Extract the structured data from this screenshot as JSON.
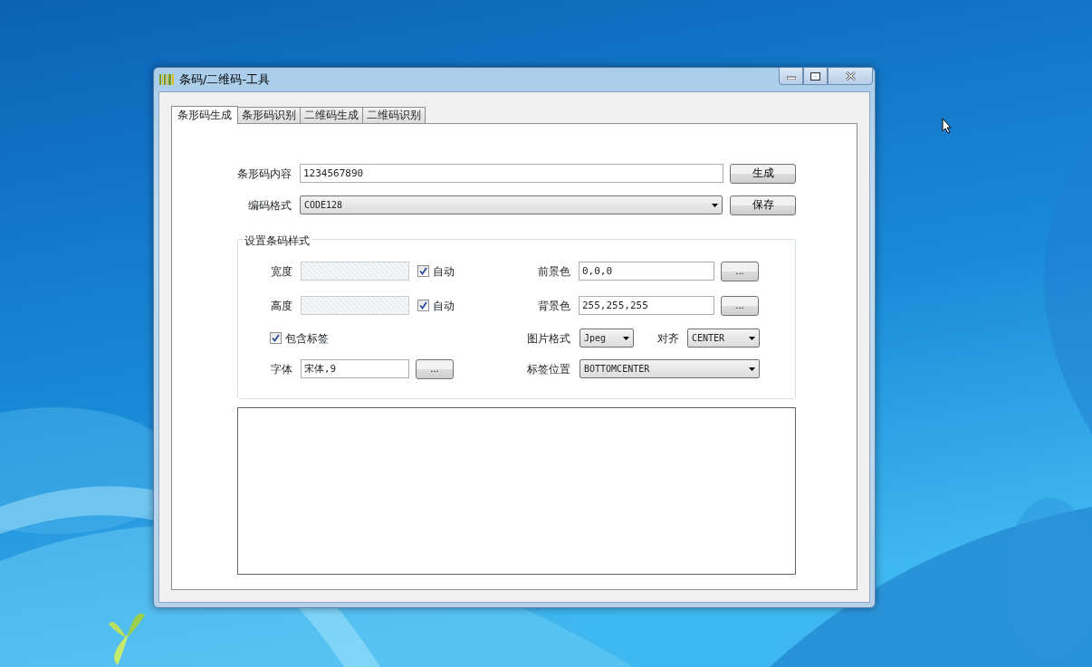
{
  "window": {
    "title": "条码/二维码-工具"
  },
  "tabs": [
    {
      "label": "条形码生成",
      "selected": true
    },
    {
      "label": "条形码识别",
      "selected": false
    },
    {
      "label": "二维码生成",
      "selected": false
    },
    {
      "label": "二维码识别",
      "selected": false
    }
  ],
  "barcode_content": {
    "label": "条形码内容",
    "value": "1234567890",
    "button": "生成"
  },
  "encoding": {
    "label": "编码格式",
    "value": "CODE128",
    "button": "保存"
  },
  "style_group": {
    "title": "设置条码样式",
    "width": {
      "label": "宽度",
      "disabled": true,
      "auto_label": "自动",
      "auto_checked": true
    },
    "height": {
      "label": "高度",
      "disabled": true,
      "auto_label": "自动",
      "auto_checked": true
    },
    "include_label": {
      "label": "包含标签",
      "checked": true
    },
    "font": {
      "label": "字体",
      "value": "宋体,9",
      "button": "..."
    },
    "foreground": {
      "label": "前景色",
      "value": "0,0,0",
      "button": "..."
    },
    "background": {
      "label": "背景色",
      "value": "255,255,255",
      "button": "..."
    },
    "image_format": {
      "label": "图片格式",
      "value": "Jpeg"
    },
    "align": {
      "label": "对齐",
      "value": "CENTER"
    },
    "label_position": {
      "label": "标签位置",
      "value": "BOTTOMCENTER"
    }
  }
}
